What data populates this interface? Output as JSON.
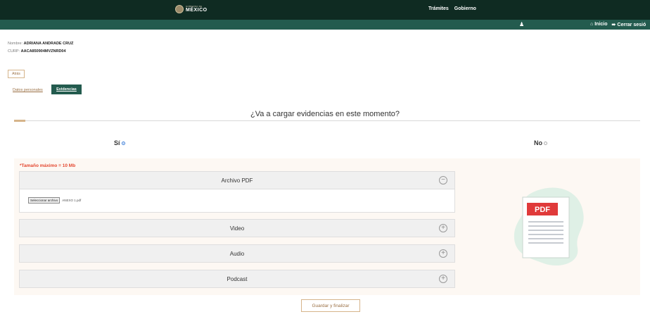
{
  "header": {
    "logo_small": "GOBIERNO DE",
    "logo_big": "MÉXICO",
    "nav": [
      "Trámites",
      "Gobierno"
    ],
    "user_icon": "user-icon",
    "sub_nav": [
      {
        "icon": "home-icon",
        "label": "Inicio"
      },
      {
        "icon": "logout-icon",
        "label": "Cerrar sesió"
      }
    ]
  },
  "user": {
    "name_label": "Nombre:",
    "name_value": "ADRIANA ANDRADE CRUZ",
    "curp_label": "CURP:",
    "curp_value": "AACA850904MVZNRD04"
  },
  "back_button": "Atrás",
  "tabs": [
    {
      "label": "Datos personales",
      "active": false
    },
    {
      "label": "Evidencias",
      "active": true
    }
  ],
  "question": "¿Va a cargar evidencias en este momento?",
  "options": [
    {
      "label": "Sí",
      "selected": true
    },
    {
      "label": "No",
      "selected": false
    }
  ],
  "max_size": "*Tamaño máximo = 10 Mb",
  "accordion": [
    {
      "title": "Archivo PDF",
      "expanded": true,
      "icon": "minus-circle-icon"
    },
    {
      "title": "Video",
      "expanded": false,
      "icon": "plus-circle-icon"
    },
    {
      "title": "Audio",
      "expanded": false,
      "icon": "plus-circle-icon"
    },
    {
      "title": "Podcast",
      "expanded": false,
      "icon": "plus-circle-icon"
    }
  ],
  "file_input": {
    "button_label": "Seleccionar archivo",
    "file_name": "ANEXO 1.pdf"
  },
  "illustration_label": "PDF",
  "save_button": "Guardar y finalizar",
  "colors": {
    "header_dark": "#0f2b22",
    "header_green": "#235b4e",
    "accent_gold": "#d6b48a",
    "error_red": "#e4472f",
    "pdf_red": "#e03a3a"
  }
}
